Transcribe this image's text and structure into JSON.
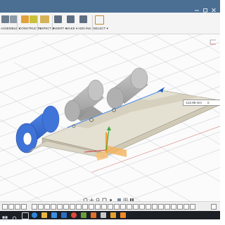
{
  "toolbar": {
    "groups": [
      {
        "label": "ASSEMBLE ▾"
      },
      {
        "label": "CONSTRUCT ▾"
      },
      {
        "label": "INSPECT ▾"
      },
      {
        "label": "INSERT ▾"
      },
      {
        "label": "MAKE ▾"
      },
      {
        "label": "ADD-INS ▾"
      },
      {
        "label": "SELECT ▾"
      }
    ]
  },
  "dimension_input": {
    "value1": "-122.88 mm",
    "value2": "0"
  },
  "colors": {
    "title_bar": "#4b6f93",
    "roll": "#3d72d8",
    "ghost_roll": "#a6a6a6",
    "plate": "#ddd8c8",
    "manipulator": "#f2a43a"
  },
  "icons": {
    "navbar": [
      "orbit-icon",
      "pan-icon",
      "zoom-icon",
      "fit-icon",
      "look-at-icon",
      "display-style-icon",
      "grid-icon",
      "viewports-icon"
    ],
    "taskbar": [
      "start-icon",
      "search-icon",
      "task-view-icon",
      "edge-icon",
      "explorer-icon",
      "store-icon",
      "mail-icon",
      "chrome-icon",
      "app-icon",
      "app-icon",
      "app-icon",
      "app-icon",
      "fusion-icon"
    ]
  }
}
